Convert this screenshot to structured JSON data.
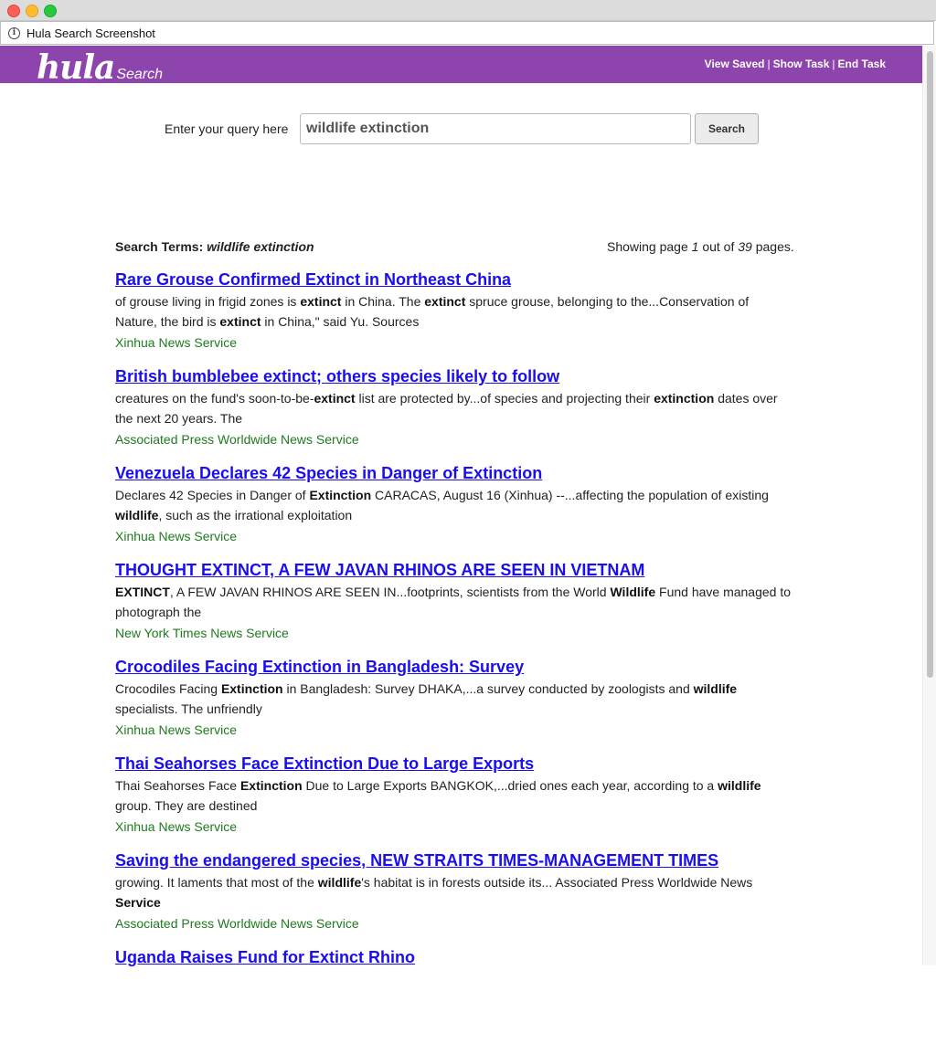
{
  "window": {
    "page_title": "Hula Search Screenshot"
  },
  "header": {
    "logo_main": "hula",
    "logo_sub": "Search",
    "links": [
      "View Saved",
      "Show Task",
      "End Task"
    ],
    "separator": "|",
    "background_color": "#8e44ad"
  },
  "search": {
    "label": "Enter your query here",
    "query": "wildlife extinction",
    "button_label": "Search"
  },
  "meta": {
    "terms_label": "Search Terms:",
    "terms_value": "wildlife extinction",
    "showing_prefix": "Showing page",
    "current_page": "1",
    "out_of": "out of",
    "total_pages": "39",
    "pages_suffix": "pages."
  },
  "colors": {
    "link": "#1a0dee",
    "source": "#1f7a1f"
  },
  "results": [
    {
      "title": "Rare Grouse Confirmed Extinct in Northeast China",
      "snippet": [
        {
          "t": "of grouse living in frigid zones is "
        },
        {
          "t": "extinct",
          "b": true
        },
        {
          "t": " in China. The "
        },
        {
          "t": "extinct",
          "b": true
        },
        {
          "t": " spruce grouse, belonging to the...Conservation of Nature, the bird is "
        },
        {
          "t": "extinct",
          "b": true
        },
        {
          "t": " in China,\" said Yu. Sources"
        }
      ],
      "source": "Xinhua News Service"
    },
    {
      "title": "British bumblebee extinct; others species likely to follow",
      "snippet": [
        {
          "t": "creatures on the fund's soon-to-be-"
        },
        {
          "t": "extinct",
          "b": true
        },
        {
          "t": " list are protected by...of species and projecting their "
        },
        {
          "t": "extinction",
          "b": true
        },
        {
          "t": " dates over the next 20 years. The"
        }
      ],
      "source": "Associated Press Worldwide News Service"
    },
    {
      "title": "Venezuela Declares 42 Species in Danger of Extinction",
      "snippet": [
        {
          "t": "Declares 42 Species in Danger of "
        },
        {
          "t": "Extinction",
          "b": true
        },
        {
          "t": " CARACAS, August 16 (Xinhua) --...affecting the population of existing "
        },
        {
          "t": "wildlife",
          "b": true
        },
        {
          "t": ", such as the irrational exploitation"
        }
      ],
      "source": "Xinhua News Service"
    },
    {
      "title": "THOUGHT EXTINCT, A FEW JAVAN RHINOS ARE SEEN IN VIETNAM",
      "snippet": [
        {
          "t": "EXTINCT",
          "b": true
        },
        {
          "t": ", A FEW JAVAN RHINOS ARE SEEN IN...footprints, scientists from the World "
        },
        {
          "t": "Wildlife",
          "b": true
        },
        {
          "t": " Fund have managed to photograph the"
        }
      ],
      "source": "New York Times News Service"
    },
    {
      "title": "Crocodiles Facing Extinction in Bangladesh: Survey",
      "snippet": [
        {
          "t": "Crocodiles Facing "
        },
        {
          "t": "Extinction",
          "b": true
        },
        {
          "t": " in Bangladesh: Survey DHAKA,...a survey conducted by zoologists and "
        },
        {
          "t": "wildlife",
          "b": true
        },
        {
          "t": " specialists. The unfriendly"
        }
      ],
      "source": "Xinhua News Service"
    },
    {
      "title": "Thai Seahorses Face Extinction Due to Large Exports",
      "snippet": [
        {
          "t": "Thai Seahorses Face "
        },
        {
          "t": "Extinction",
          "b": true
        },
        {
          "t": " Due to Large Exports BANGKOK,...dried ones each year, according to a "
        },
        {
          "t": "wildlife",
          "b": true
        },
        {
          "t": " group. They are destined"
        }
      ],
      "source": "Xinhua News Service"
    },
    {
      "title": "Saving the endangered species, NEW STRAITS TIMES-MANAGEMENT TIMES",
      "snippet": [
        {
          "t": "growing. It laments that most of the "
        },
        {
          "t": "wildlife",
          "b": true
        },
        {
          "t": "'s habitat is in forests outside its... Associated Press Worldwide News "
        },
        {
          "t": "Service",
          "b": true
        }
      ],
      "source": "Associated Press Worldwide News Service"
    },
    {
      "title": "Uganda Raises Fund for Extinct Rhino",
      "snippet": [],
      "source": ""
    }
  ]
}
